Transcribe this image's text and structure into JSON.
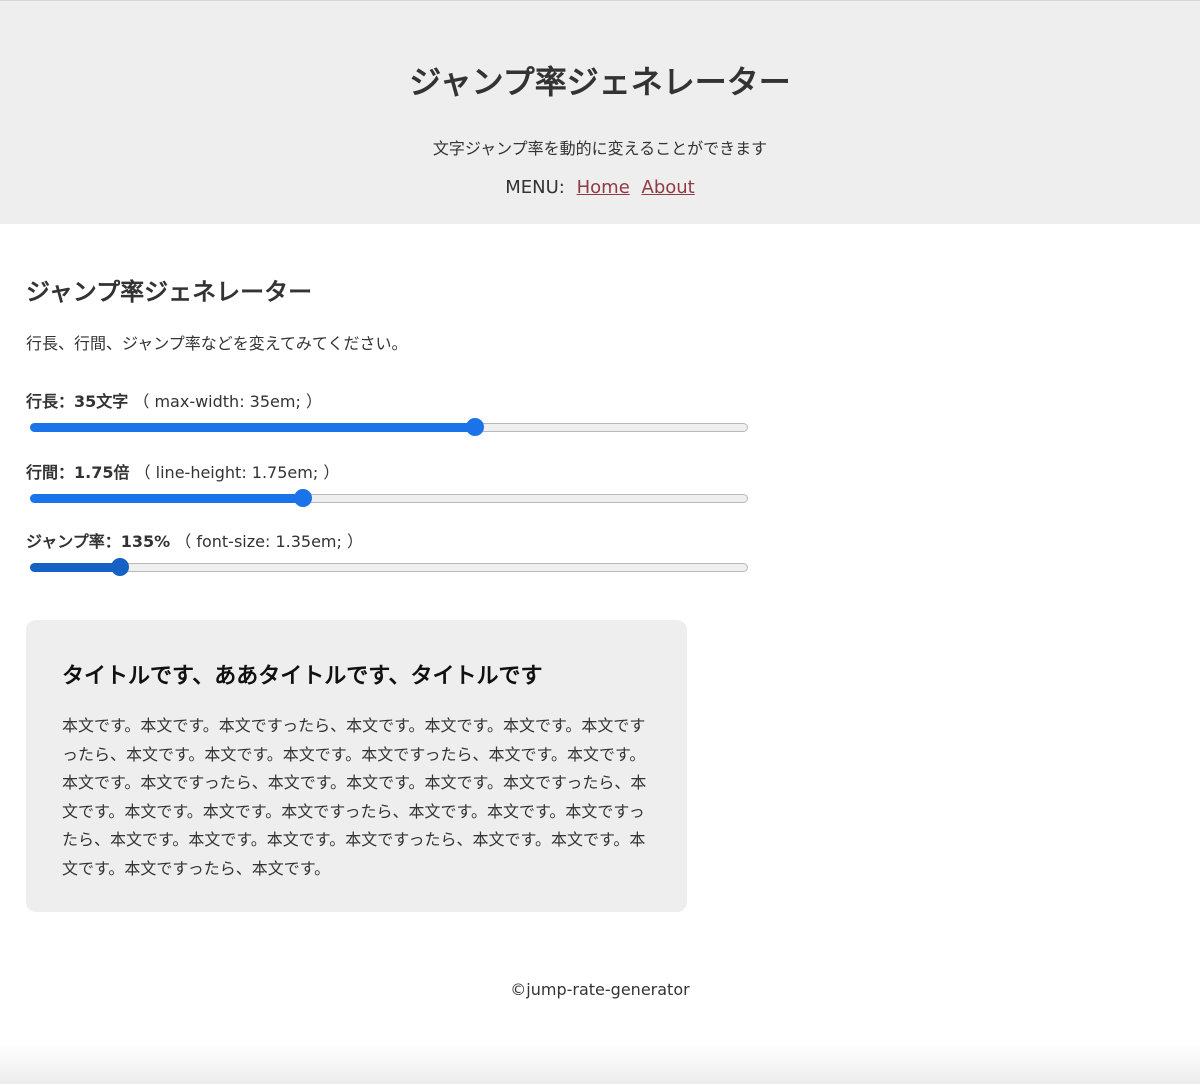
{
  "header": {
    "title": "ジャンプ率ジェネレーター",
    "subtitle": "文字ジャンプ率を動的に変えることができます",
    "menu_label": "MENU:",
    "menu_items": [
      "Home",
      "About"
    ]
  },
  "main": {
    "heading": "ジャンプ率ジェネレーター",
    "intro": "行長、行間、ジャンプ率などを変えてみてください。",
    "controls": [
      {
        "label": "行長：35文字",
        "css": "（ max-width: 35em; ）",
        "fraction": 0.62
      },
      {
        "label": "行間：1.75倍",
        "css": "（ line-height: 1.75em; ）",
        "fraction": 0.38
      },
      {
        "label": "ジャンプ率：135%",
        "css": "（ font-size: 1.35em; ）",
        "fraction": 0.125
      }
    ]
  },
  "preview": {
    "title": "タイトルです、ああタイトルです、タイトルです",
    "body": "本文です。本文です。本文ですったら、本文です。本文です。本文です。本文ですったら、本文です。本文です。本文です。本文ですったら、本文です。本文です。本文です。本文ですったら、本文です。本文です。本文です。本文ですったら、本文です。本文です。本文です。本文ですったら、本文です。本文です。本文ですったら、本文です。本文です。本文です。本文ですったら、本文です。本文です。本文です。本文ですったら、本文です。"
  },
  "footer": {
    "text": "©jump-rate-generator"
  },
  "colors": {
    "header_bg": "#eeeeee",
    "link": "#8e3b46",
    "slider_accent": "#1a73e8",
    "card_bg": "#eeeeee"
  }
}
